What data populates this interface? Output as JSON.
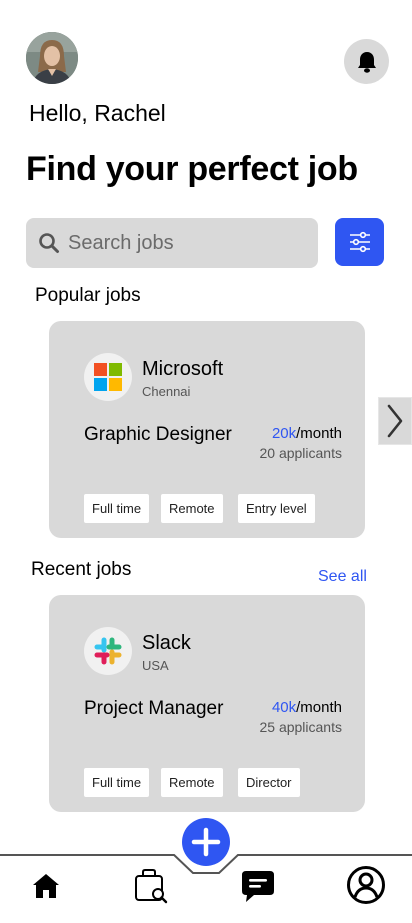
{
  "header": {
    "greeting": "Hello, Rachel",
    "headline": "Find your perfect job",
    "avatar_icon": "user-avatar-photo",
    "notification_icon": "bell-icon"
  },
  "search": {
    "placeholder": "Search jobs",
    "filter_icon": "sliders-icon"
  },
  "popular": {
    "title": "Popular jobs",
    "cards": [
      {
        "company": "Microsoft",
        "location": "Chennai",
        "job_title": "Graphic Designer",
        "salary_amount": "20k",
        "salary_unit": "/month",
        "applicants": "20 applicants",
        "tags": [
          "Full time",
          "Remote",
          "Entry level"
        ]
      }
    ]
  },
  "recent": {
    "title": "Recent jobs",
    "see_all": "See all",
    "cards": [
      {
        "company": "Slack",
        "location": "USA",
        "job_title": "Project Manager",
        "salary_amount": "40k",
        "salary_unit": "/month",
        "applicants": "25 applicants",
        "tags": [
          "Full time",
          "Remote",
          "Director"
        ]
      }
    ]
  },
  "nav": {
    "items": [
      "home-icon",
      "job-search-icon",
      "chat-icon",
      "profile-icon"
    ],
    "fab_icon": "plus-icon"
  },
  "colors": {
    "accent": "#2f56f2",
    "card_bg": "#d9d9d9"
  }
}
